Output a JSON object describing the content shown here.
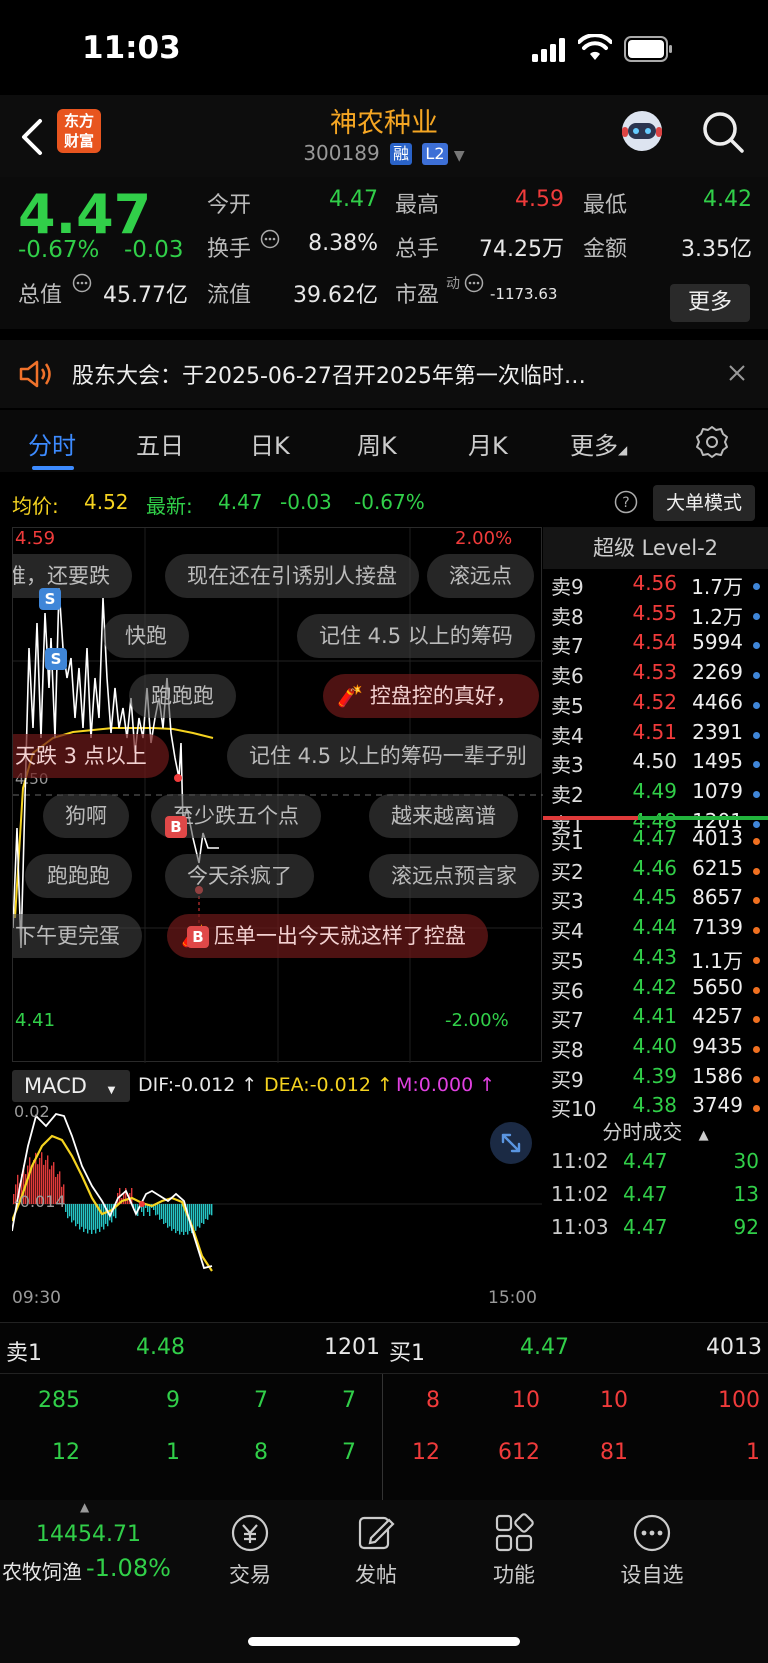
{
  "status": {
    "time": "11:03"
  },
  "nav": {
    "logo_line1": "东方",
    "logo_line2": "财富",
    "stock_name": "神农种业",
    "code": "300189",
    "tag_margin": "融",
    "tag_l2": "L2"
  },
  "quote": {
    "last": "4.47",
    "pct": "-0.67%",
    "chg": "-0.03",
    "open_label": "今开",
    "open": "4.47",
    "high_label": "最高",
    "high": "4.59",
    "low_label": "最低",
    "low": "4.42",
    "turnover_label": "换手",
    "turnover": "8.38%",
    "volume_label": "总手",
    "volume": "74.25万",
    "amount_label": "金额",
    "amount": "3.35亿",
    "mcap_label": "总值",
    "mcap": "45.77亿",
    "float_label": "流值",
    "float": "39.62亿",
    "pe_label": "市盈",
    "pe_sup": "动",
    "pe": "-1173.63",
    "more": "更多"
  },
  "notice": {
    "text": "股东大会：于2025-06-27召开2025年第一次临时…"
  },
  "tabs": [
    "分时",
    "五日",
    "日K",
    "周K",
    "月K",
    "更多"
  ],
  "chart_header": {
    "avg_label": "均价:",
    "avg": "4.52",
    "latest_label": "最新:",
    "latest": "4.47",
    "chg": "-0.03",
    "pct": "-0.67%",
    "bigorder": "大单模式"
  },
  "chart_labels": {
    "top_price": "4.59",
    "bottom_price": "4.41",
    "top_pct": "2.00%",
    "bottom_pct": "-2.00%",
    "mid_price": "4.50"
  },
  "comments": [
    {
      "t": "谁，还要跌"
    },
    {
      "t": "现在还在引诱别人接盘"
    },
    {
      "t": "滚远点"
    },
    {
      "t": "快跑"
    },
    {
      "t": "记住 4.5 以上的筹码"
    },
    {
      "t": "跑跑跑"
    },
    {
      "t": "控盘控的真好，"
    },
    {
      "t": "天跌 3 点以上"
    },
    {
      "t": "记住 4.5 以上的筹码一辈子别"
    },
    {
      "t": "狗啊"
    },
    {
      "t": "至少跌五个点"
    },
    {
      "t": "越来越离谱"
    },
    {
      "t": "跑跑跑"
    },
    {
      "t": "今天杀疯了"
    },
    {
      "t": "滚远点预言家"
    },
    {
      "t": "下午更完蛋"
    },
    {
      "t": "压单一出今天就这样了控盘"
    }
  ],
  "markers": {
    "s": "S",
    "b": "B"
  },
  "orderbook": {
    "title": "超级 Level-2",
    "asks": [
      {
        "l": "卖9",
        "p": "4.56",
        "v": "1.7万",
        "c": "#f03b3b"
      },
      {
        "l": "卖8",
        "p": "4.55",
        "v": "1.2万",
        "c": "#f03b3b"
      },
      {
        "l": "卖7",
        "p": "4.54",
        "v": "5994",
        "c": "#f03b3b"
      },
      {
        "l": "卖6",
        "p": "4.53",
        "v": "2269",
        "c": "#f03b3b"
      },
      {
        "l": "卖5",
        "p": "4.52",
        "v": "4466",
        "c": "#f03b3b"
      },
      {
        "l": "卖4",
        "p": "4.51",
        "v": "2391",
        "c": "#f03b3b"
      },
      {
        "l": "卖3",
        "p": "4.50",
        "v": "1495",
        "c": "#e8e8e8"
      },
      {
        "l": "卖2",
        "p": "4.49",
        "v": "1079",
        "c": "#31cf49"
      },
      {
        "l": "卖1",
        "p": "4.48",
        "v": "1201",
        "c": "#31cf49"
      }
    ],
    "bids": [
      {
        "l": "买1",
        "p": "4.47",
        "v": "4013",
        "c": "#31cf49"
      },
      {
        "l": "买2",
        "p": "4.46",
        "v": "6215",
        "c": "#31cf49"
      },
      {
        "l": "买3",
        "p": "4.45",
        "v": "8657",
        "c": "#31cf49"
      },
      {
        "l": "买4",
        "p": "4.44",
        "v": "7139",
        "c": "#31cf49"
      },
      {
        "l": "买5",
        "p": "4.43",
        "v": "1.1万",
        "c": "#31cf49"
      },
      {
        "l": "买6",
        "p": "4.42",
        "v": "5650",
        "c": "#31cf49"
      },
      {
        "l": "买7",
        "p": "4.41",
        "v": "4257",
        "c": "#31cf49"
      },
      {
        "l": "买8",
        "p": "4.40",
        "v": "9435",
        "c": "#31cf49"
      },
      {
        "l": "买9",
        "p": "4.39",
        "v": "1586",
        "c": "#31cf49"
      },
      {
        "l": "买10",
        "p": "4.38",
        "v": "3749",
        "c": "#31cf49"
      }
    ],
    "ticks_title": "分时成交",
    "ticks": [
      {
        "t": "11:02",
        "p": "4.47",
        "v": "30"
      },
      {
        "t": "11:02",
        "p": "4.47",
        "v": "13"
      },
      {
        "t": "11:03",
        "p": "4.47",
        "v": "92"
      }
    ]
  },
  "macd": {
    "name": "MACD",
    "dif": "DIF:-0.012 ↑",
    "dea": "DEA:-0.012 ↑",
    "m": "M:0.000 ↑",
    "ytop": "0.02",
    "ybot": "-0.014",
    "xstart": "09:30",
    "xend": "15:00"
  },
  "bottom": {
    "sell_label": "卖1",
    "sell_px": "4.48",
    "sell_vol": "1201",
    "buy_label": "买1",
    "buy_px": "4.47",
    "buy_vol": "4013",
    "sell_rows": [
      [
        "285",
        "9",
        "7",
        "7"
      ],
      [
        "12",
        "1",
        "8",
        "7"
      ]
    ],
    "buy_rows": [
      [
        "8",
        "10",
        "10",
        "100"
      ],
      [
        "12",
        "612",
        "81",
        "1"
      ]
    ]
  },
  "tabbar": {
    "index_value": "14454.71",
    "index_name": "农牧饲渔",
    "index_pct": "-1.08%",
    "trade": "交易",
    "post": "发帖",
    "func": "功能",
    "watch": "设自选"
  }
}
